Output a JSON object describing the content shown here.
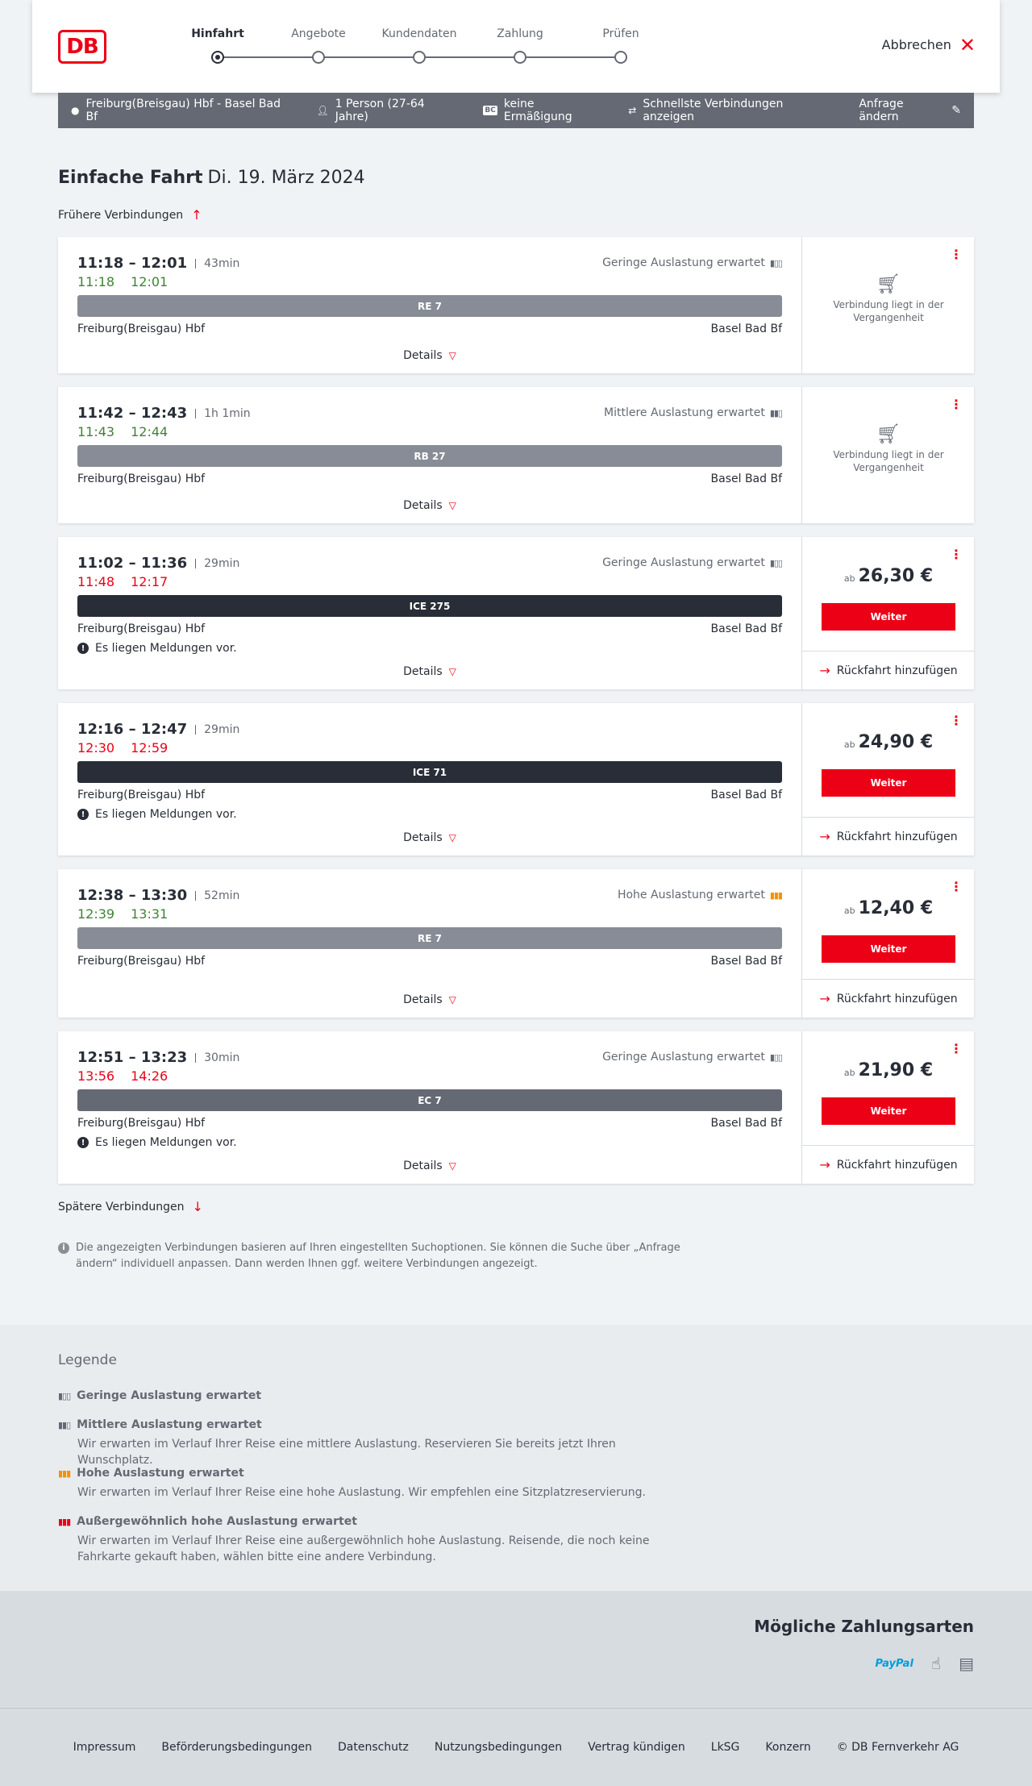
{
  "header": {
    "logo": "DB",
    "steps": [
      "Hinfahrt",
      "Angebote",
      "Kundendaten",
      "Zahlung",
      "Prüfen"
    ],
    "active_step": 0,
    "cancel_label": "Abbrechen"
  },
  "searchbar": {
    "route": "Freiburg(Breisgau) Hbf - Basel Bad Bf",
    "travellers": "1 Person (27-64 Jahre)",
    "discount_badge": "BC",
    "discount": "keine Ermäßigung",
    "option": "Schnellste Verbindungen anzeigen",
    "change": "Anfrage ändern"
  },
  "title": {
    "type": "Einfache Fahrt",
    "date": "Di. 19. März 2024"
  },
  "earlier_label": "Frühere Verbindungen",
  "later_label": "Spätere Verbindungen",
  "connections": [
    {
      "times": "11:18 – 12:01",
      "duration": "43min",
      "rt_dep": "11:18",
      "rt_arr": "12:01",
      "rt_status": "green",
      "load": "Geringe Auslastung erwartet",
      "load_level": "low",
      "train": "RE 7",
      "train_color": "#878c96",
      "from": "Freiburg(Breisgau) Hbf",
      "to": "Basel Bad Bf",
      "message": "",
      "details": "Details",
      "past": "Verbindung liegt in der Vergangenheit"
    },
    {
      "times": "11:42 – 12:43",
      "duration": "1h 1min",
      "rt_dep": "11:43",
      "rt_arr": "12:44",
      "rt_status": "green",
      "load": "Mittlere Auslastung erwartet",
      "load_level": "medium",
      "train": "RB 27",
      "train_color": "#878c96",
      "from": "Freiburg(Breisgau) Hbf",
      "to": "Basel Bad Bf",
      "message": "",
      "details": "Details",
      "past": "Verbindung liegt in der Vergangenheit"
    },
    {
      "times": "11:02 – 11:36",
      "duration": "29min",
      "rt_dep": "11:48",
      "rt_arr": "12:17",
      "rt_status": "red",
      "load": "Geringe Auslastung erwartet",
      "load_level": "low",
      "train": "ICE 275",
      "train_color": "#282d37",
      "from": "Freiburg(Breisgau) Hbf",
      "to": "Basel Bad Bf",
      "message": "Es liegen Meldungen vor.",
      "details": "Details",
      "price_prefix": "ab",
      "price": "26,30 €",
      "button": "Weiter",
      "return": "Rückfahrt hinzufügen"
    },
    {
      "times": "12:16 – 12:47",
      "duration": "29min",
      "rt_dep": "12:30",
      "rt_arr": "12:59",
      "rt_status": "red",
      "load": "",
      "load_level": "",
      "train": "ICE 71",
      "train_color": "#282d37",
      "from": "Freiburg(Breisgau) Hbf",
      "to": "Basel Bad Bf",
      "message": "Es liegen Meldungen vor.",
      "details": "Details",
      "price_prefix": "ab",
      "price": "24,90 €",
      "button": "Weiter",
      "return": "Rückfahrt hinzufügen"
    },
    {
      "times": "12:38 – 13:30",
      "duration": "52min",
      "rt_dep": "12:39",
      "rt_arr": "13:31",
      "rt_status": "green",
      "load": "Hohe Auslastung erwartet",
      "load_level": "high",
      "train": "RE 7",
      "train_color": "#878c96",
      "from": "Freiburg(Breisgau) Hbf",
      "to": "Basel Bad Bf",
      "message": "",
      "details": "Details",
      "price_prefix": "ab",
      "price": "12,40 €",
      "button": "Weiter",
      "return": "Rückfahrt hinzufügen"
    },
    {
      "times": "12:51 – 13:23",
      "duration": "30min",
      "rt_dep": "13:56",
      "rt_arr": "14:26",
      "rt_status": "red",
      "load": "Geringe Auslastung erwartet",
      "load_level": "low",
      "train": "EC 7",
      "train_color": "#646973",
      "from": "Freiburg(Breisgau) Hbf",
      "to": "Basel Bad Bf",
      "message": "Es liegen Meldungen vor.",
      "details": "Details",
      "price_prefix": "ab",
      "price": "21,90 €",
      "button": "Weiter",
      "return": "Rückfahrt hinzufügen"
    }
  ],
  "info_text": "Die angezeigten Verbindungen basieren auf Ihren eingestellten Suchoptionen. Sie können die Suche über „Anfrage ändern“ individuell anpassen. Dann werden Ihnen ggf. weitere Verbindungen angezeigt.",
  "legend": {
    "title": "Legende",
    "items": [
      {
        "title": "Geringe Auslastung erwartet",
        "desc": ""
      },
      {
        "title": "Mittlere Auslastung erwartet",
        "desc": "Wir erwarten im Verlauf Ihrer Reise eine mittlere Auslastung. Reservieren Sie bereits jetzt Ihren Wunschplatz."
      },
      {
        "title": "Hohe Auslastung erwartet",
        "desc": "Wir erwarten im Verlauf Ihrer Reise eine hohe Auslastung. Wir empfehlen eine Sitzplatzreservierung."
      },
      {
        "title": "Außergewöhnlich hohe Auslastung erwartet",
        "desc": "Wir erwarten im Verlauf Ihrer Reise eine außergewöhnlich hohe Auslastung. Reisende, die noch keine Fahrkarte gekauft haben, wählen bitte eine andere Verbindung."
      }
    ]
  },
  "payment": {
    "title": "Mögliche Zahlungsarten",
    "paypal": "PayPal",
    "icons": [
      "paypal-icon",
      "credit-card-icon",
      "sepa-icon"
    ]
  },
  "footer": [
    "Impressum",
    "Beförderungsbedingungen",
    "Datenschutz",
    "Nutzungsbedingungen",
    "Vertrag kündigen",
    "LkSG",
    "Konzern",
    "© DB Fernverkehr AG"
  ]
}
